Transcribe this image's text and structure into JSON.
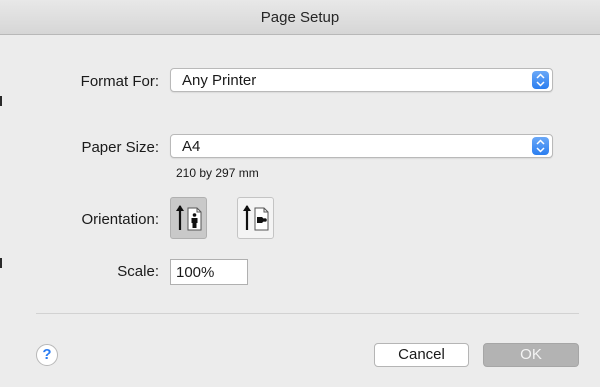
{
  "window": {
    "title": "Page Setup"
  },
  "format_for": {
    "label": "Format For:",
    "value": "Any Printer"
  },
  "paper_size": {
    "label": "Paper Size:",
    "value": "A4",
    "dimensions": "210 by 297 mm"
  },
  "orientation": {
    "label": "Orientation:",
    "options": [
      "portrait",
      "landscape"
    ],
    "selected": "portrait"
  },
  "scale": {
    "label": "Scale:",
    "value": "100%"
  },
  "footer": {
    "help_label": "?",
    "cancel_label": "Cancel",
    "ok_label": "OK"
  },
  "colors": {
    "accent": "#2b7ef0",
    "ok_disabled": "#b3b3b3",
    "background": "#ececec"
  }
}
